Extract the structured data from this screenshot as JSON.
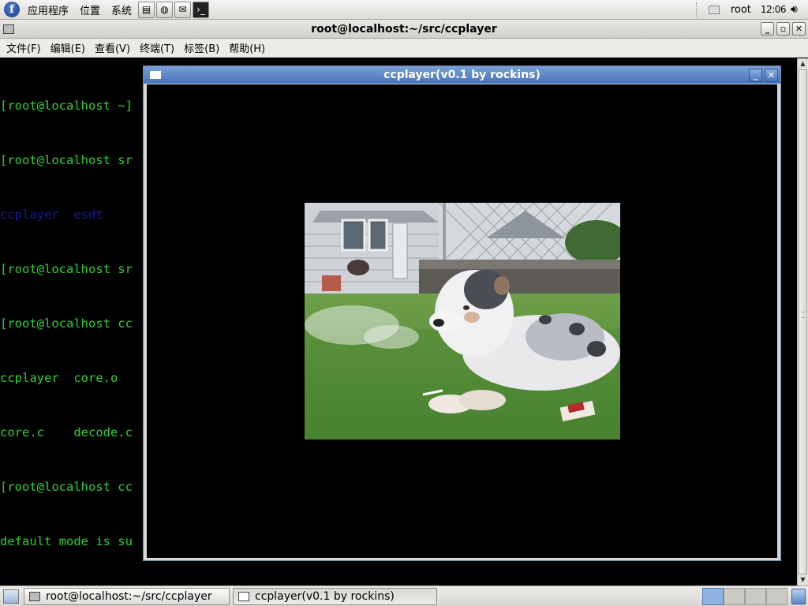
{
  "top_panel": {
    "menus": [
      "应用程序",
      "位置",
      "系统"
    ],
    "user": "root",
    "clock": "12:06"
  },
  "terminal": {
    "title": "root@localhost:~/src/ccplayer",
    "menu": [
      "文件(F)",
      "编辑(E)",
      "查看(V)",
      "终端(T)",
      "标签(B)",
      "帮助(H)"
    ],
    "lines": [
      {
        "text": "[root@localhost ~]",
        "color": "green"
      },
      {
        "text": "[root@localhost sr",
        "color": "green"
      },
      {
        "text": "ccplayer  esdt",
        "color": "blue"
      },
      {
        "text": "[root@localhost sr",
        "color": "green"
      },
      {
        "text": "[root@localhost cc",
        "color": "green"
      },
      {
        "text": "ccplayer  core.o",
        "color": "green"
      },
      {
        "text": "core.c    decode.c",
        "color": "green"
      },
      {
        "text": "[root@localhost cc",
        "color": "green"
      },
      {
        "text": "default mode is su",
        "color": "green"
      }
    ]
  },
  "player": {
    "title": "ccplayer(v0.1 by rockins)"
  },
  "taskbar": {
    "tasks": [
      {
        "label": "root@localhost:~/src/ccplayer",
        "active": false
      },
      {
        "label": "ccplayer(v0.1 by rockins)",
        "active": true
      }
    ],
    "workspaces": 4,
    "active_workspace": 1
  },
  "colors": {
    "terminal_green": "#2fd12f",
    "terminal_blue": "#1a1a9c",
    "titlebar_blue": "#4572b8"
  }
}
